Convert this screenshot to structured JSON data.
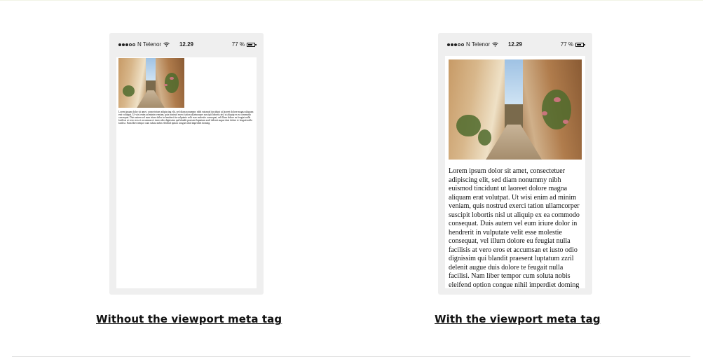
{
  "status_bar": {
    "carrier": "N Telenor",
    "time": "12.29",
    "battery": "77 %",
    "battery_level": 0.77,
    "signal_icon": "signal-dots-icon",
    "wifi_icon": "wifi-icon",
    "battery_icon": "battery-icon"
  },
  "article": {
    "text": "Lorem ipsum dolor sit amet, consectetuer adipiscing elit, sed diam nonummy nibh euismod tincidunt ut laoreet dolore magna aliquam erat volutpat. Ut wisi enim ad minim veniam, quis nostrud exerci tation ullamcorper suscipit lobortis nisl ut aliquip ex ea commodo consequat. Duis autem vel eum iriure dolor in hendrerit in vulputate velit esse molestie consequat, vel illum dolore eu feugiat nulla facilisis at vero eros et accumsan et iusto odio dignissim qui blandit praesent luptatum zzril delenit augue duis dolore te feugait nulla facilisi. Nam liber tempor cum soluta nobis eleifend option congue nihil imperdiet doming"
  },
  "captions": {
    "without": "Without the viewport meta tag",
    "with": "With the viewport meta tag"
  }
}
